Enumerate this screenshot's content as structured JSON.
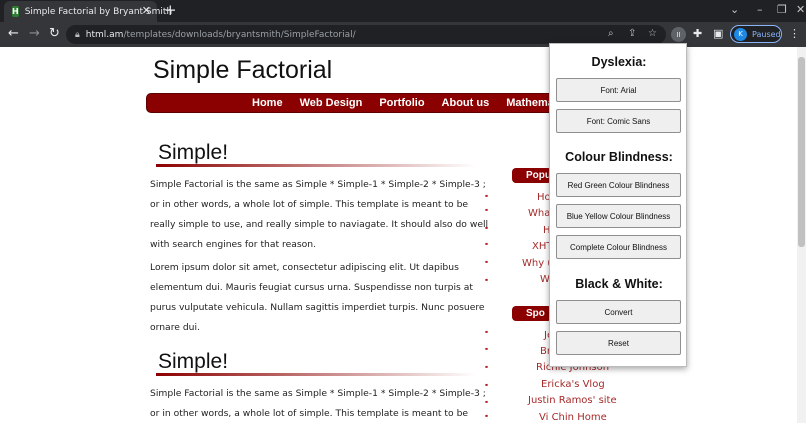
{
  "browser": {
    "tab_title": "Simple Factorial by Bryant Smith",
    "favicon_letter": "H",
    "url_host": "html.am",
    "url_path": "/templates/downloads/bryantsmith/SimpleFactorial/",
    "profile_initial": "K",
    "profile_status": "Paused",
    "extension_badge": "II",
    "icons": {
      "close_tab": "close-icon",
      "new_tab": "plus-icon",
      "back": "arrow-left-icon",
      "forward": "arrow-right-icon",
      "reload": "reload-icon",
      "lock": "lock-icon",
      "zoom": "zoom-icon",
      "share": "share-icon",
      "bookmark": "star-icon",
      "extensions": "puzzle-icon",
      "sidebar": "sidebar-icon",
      "menu": "more-vertical-icon"
    }
  },
  "site": {
    "title": "Simple Factorial",
    "nav": [
      "Home",
      "Web Design",
      "Portfolio",
      "About us",
      "Mathema"
    ],
    "sections": [
      {
        "heading": "Simple!",
        "paragraphs": [
          "Simple Factorial is the same as Simple * Simple-1 * Simple-2 * Simple-3 ; or in other words, a whole lot of simple. This template is meant to be really simple to use, and really simple to naviagate. It should also do well with search engines for that reason.",
          "Lorem ipsum dolor sit amet, consectetur adipiscing elit. Ut dapibus elementum dui. Mauris feugiat cursus urna. Suspendisse non turpis at purus vulputate vehicula. Nullam sagittis imperdiet turpis. Nunc posuere ornare dui."
        ]
      },
      {
        "heading": "Simple!",
        "paragraphs": [
          "Simple Factorial is the same as Simple * Simple-1 * Simple-2 * Simple-3 ; or in other words, a whole lot of simple. This template is meant to be really simple to use"
        ]
      }
    ],
    "sidebar": {
      "popular_heading": "Popu",
      "popular_links": [
        "Ho",
        "What",
        "H",
        "XHT",
        "Why u",
        "W"
      ],
      "sponsors_heading": "Spo",
      "sponsor_links": [
        "Je",
        "Br",
        "Richie Johnson",
        "Ericka's Vlog",
        "Justin Ramos' site",
        "Vi Chin Home"
      ]
    }
  },
  "popup": {
    "dyslexia_heading": "Dyslexia:",
    "font_arial": "Font: Arial",
    "font_comic": "Font: Comic Sans",
    "colour_heading": "Colour Blindness:",
    "red_green": "Red Green Colour Blindness",
    "blue_yellow": "Blue Yellow Colour Blindness",
    "complete": "Complete Colour Blindness",
    "bw_heading": "Black & White:",
    "convert": "Convert",
    "reset": "Reset"
  },
  "colors": {
    "nav_bg": "#8b0000",
    "link": "#a52a2a",
    "chrome_dark": "#202124",
    "chrome_toolbar": "#35363a"
  }
}
